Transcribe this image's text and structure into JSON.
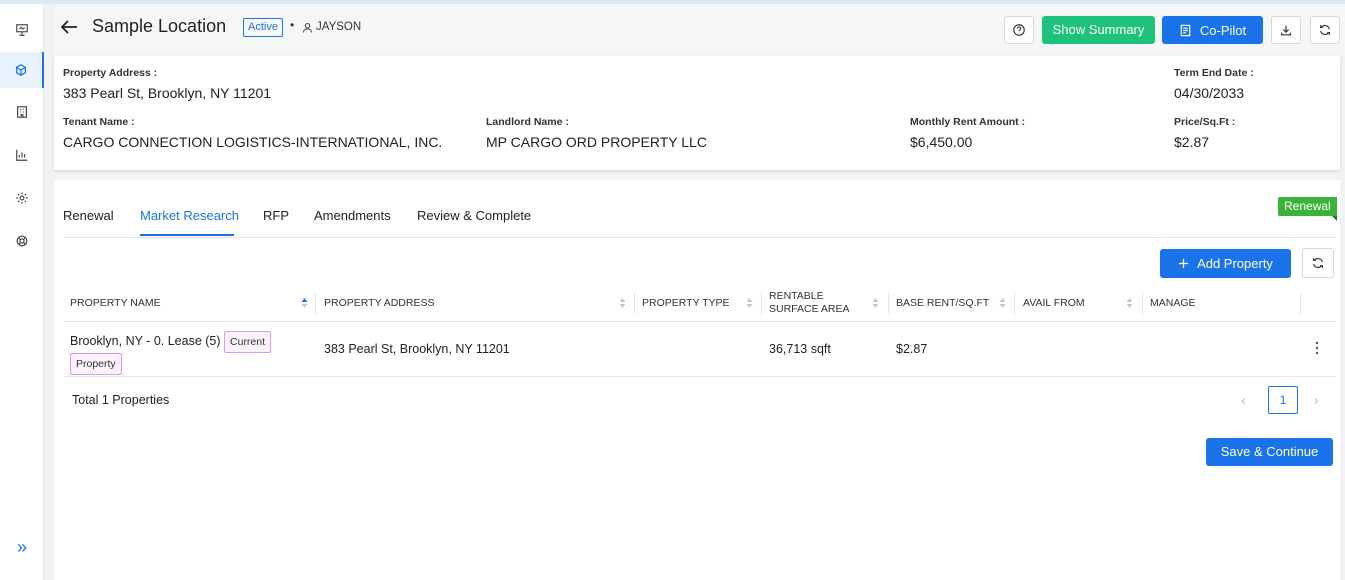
{
  "header": {
    "title": "Sample Location",
    "status": "Active",
    "separator": "•",
    "user": "JAYSON",
    "show_summary_label": "Show Summary",
    "copilot_label": "Co-Pilot"
  },
  "info": {
    "property_address_label": "Property Address :",
    "property_address": "383 Pearl St, Brooklyn, NY 11201",
    "term_end_label": "Term End Date :",
    "term_end": "04/30/2033",
    "tenant_label": "Tenant Name :",
    "tenant": "CARGO CONNECTION LOGISTICS-INTERNATIONAL, INC.",
    "landlord_label": "Landlord Name :",
    "landlord": "MP CARGO ORD PROPERTY LLC",
    "rent_label": "Monthly Rent Amount :",
    "rent": "$6,450.00",
    "price_label": "Price/Sq.Ft :",
    "price": "$2.87"
  },
  "tabs": [
    {
      "label": "Renewal"
    },
    {
      "label": "Market Research"
    },
    {
      "label": "RFP"
    },
    {
      "label": "Amendments"
    },
    {
      "label": "Review & Complete"
    }
  ],
  "renewal_flag": "Renewal",
  "add_property_label": "Add Property",
  "table": {
    "columns": [
      "PROPERTY NAME",
      "PROPERTY ADDRESS",
      "PROPERTY TYPE",
      "RENTABLE",
      "SURFACE AREA",
      "BASE RENT/SQ.FT",
      "AVAIL FROM",
      "MANAGE"
    ],
    "rows": [
      {
        "name": "Brooklyn, NY - 0. Lease (5)",
        "badge_1": "Current",
        "badge_2": "Property",
        "address": "383 Pearl St, Brooklyn, NY 11201",
        "type": "",
        "area": "36,713 sqft",
        "base_rent": "$2.87",
        "avail_from": ""
      }
    ]
  },
  "total": "Total 1 Properties",
  "pagination": {
    "page": "1",
    "prev": "‹",
    "next": "›"
  },
  "save_label": "Save & Continue",
  "sidebar_expand": "»",
  "colors": {
    "primary": "#1a73e8",
    "success": "#1fc27d",
    "renewal": "#3bb33b"
  }
}
